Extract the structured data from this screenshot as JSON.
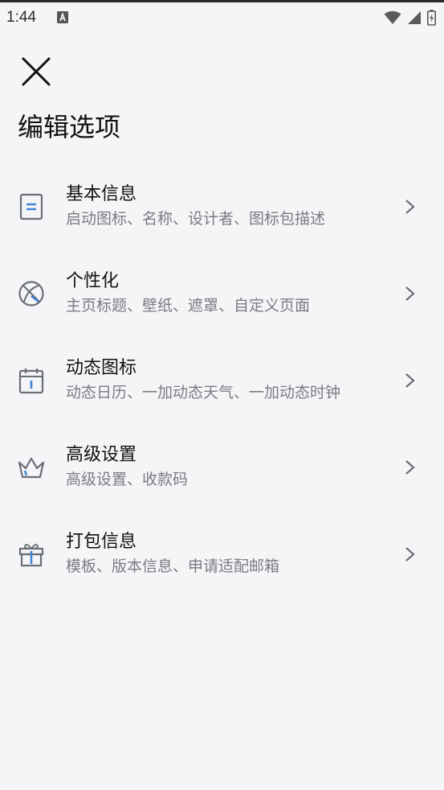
{
  "status_bar": {
    "time": "1:44",
    "notification_icon": "a-box-icon",
    "icons": [
      "wifi-icon",
      "signal-icon",
      "battery-charging-icon"
    ]
  },
  "header": {
    "close_icon": "close-icon",
    "title": "编辑选项"
  },
  "menu": {
    "items": [
      {
        "icon": "document-icon",
        "title": "基本信息",
        "description": "启动图标、名称、设计者、图标包描述"
      },
      {
        "icon": "basketball-icon",
        "title": "个性化",
        "description": "主页标题、壁纸、遮罩、自定义页面"
      },
      {
        "icon": "calendar-icon",
        "title": "动态图标",
        "description": "动态日历、一加动态天气、一加动态时钟"
      },
      {
        "icon": "crown-icon",
        "title": "高级设置",
        "description": "高级设置、收款码"
      },
      {
        "icon": "gift-icon",
        "title": "打包信息",
        "description": "模板、版本信息、申请适配邮箱"
      }
    ]
  },
  "colors": {
    "background": "#f4f5f7",
    "accent": "#3f84d6",
    "icon_gray": "#6b6e74",
    "secondary_text": "#7b7c80"
  }
}
